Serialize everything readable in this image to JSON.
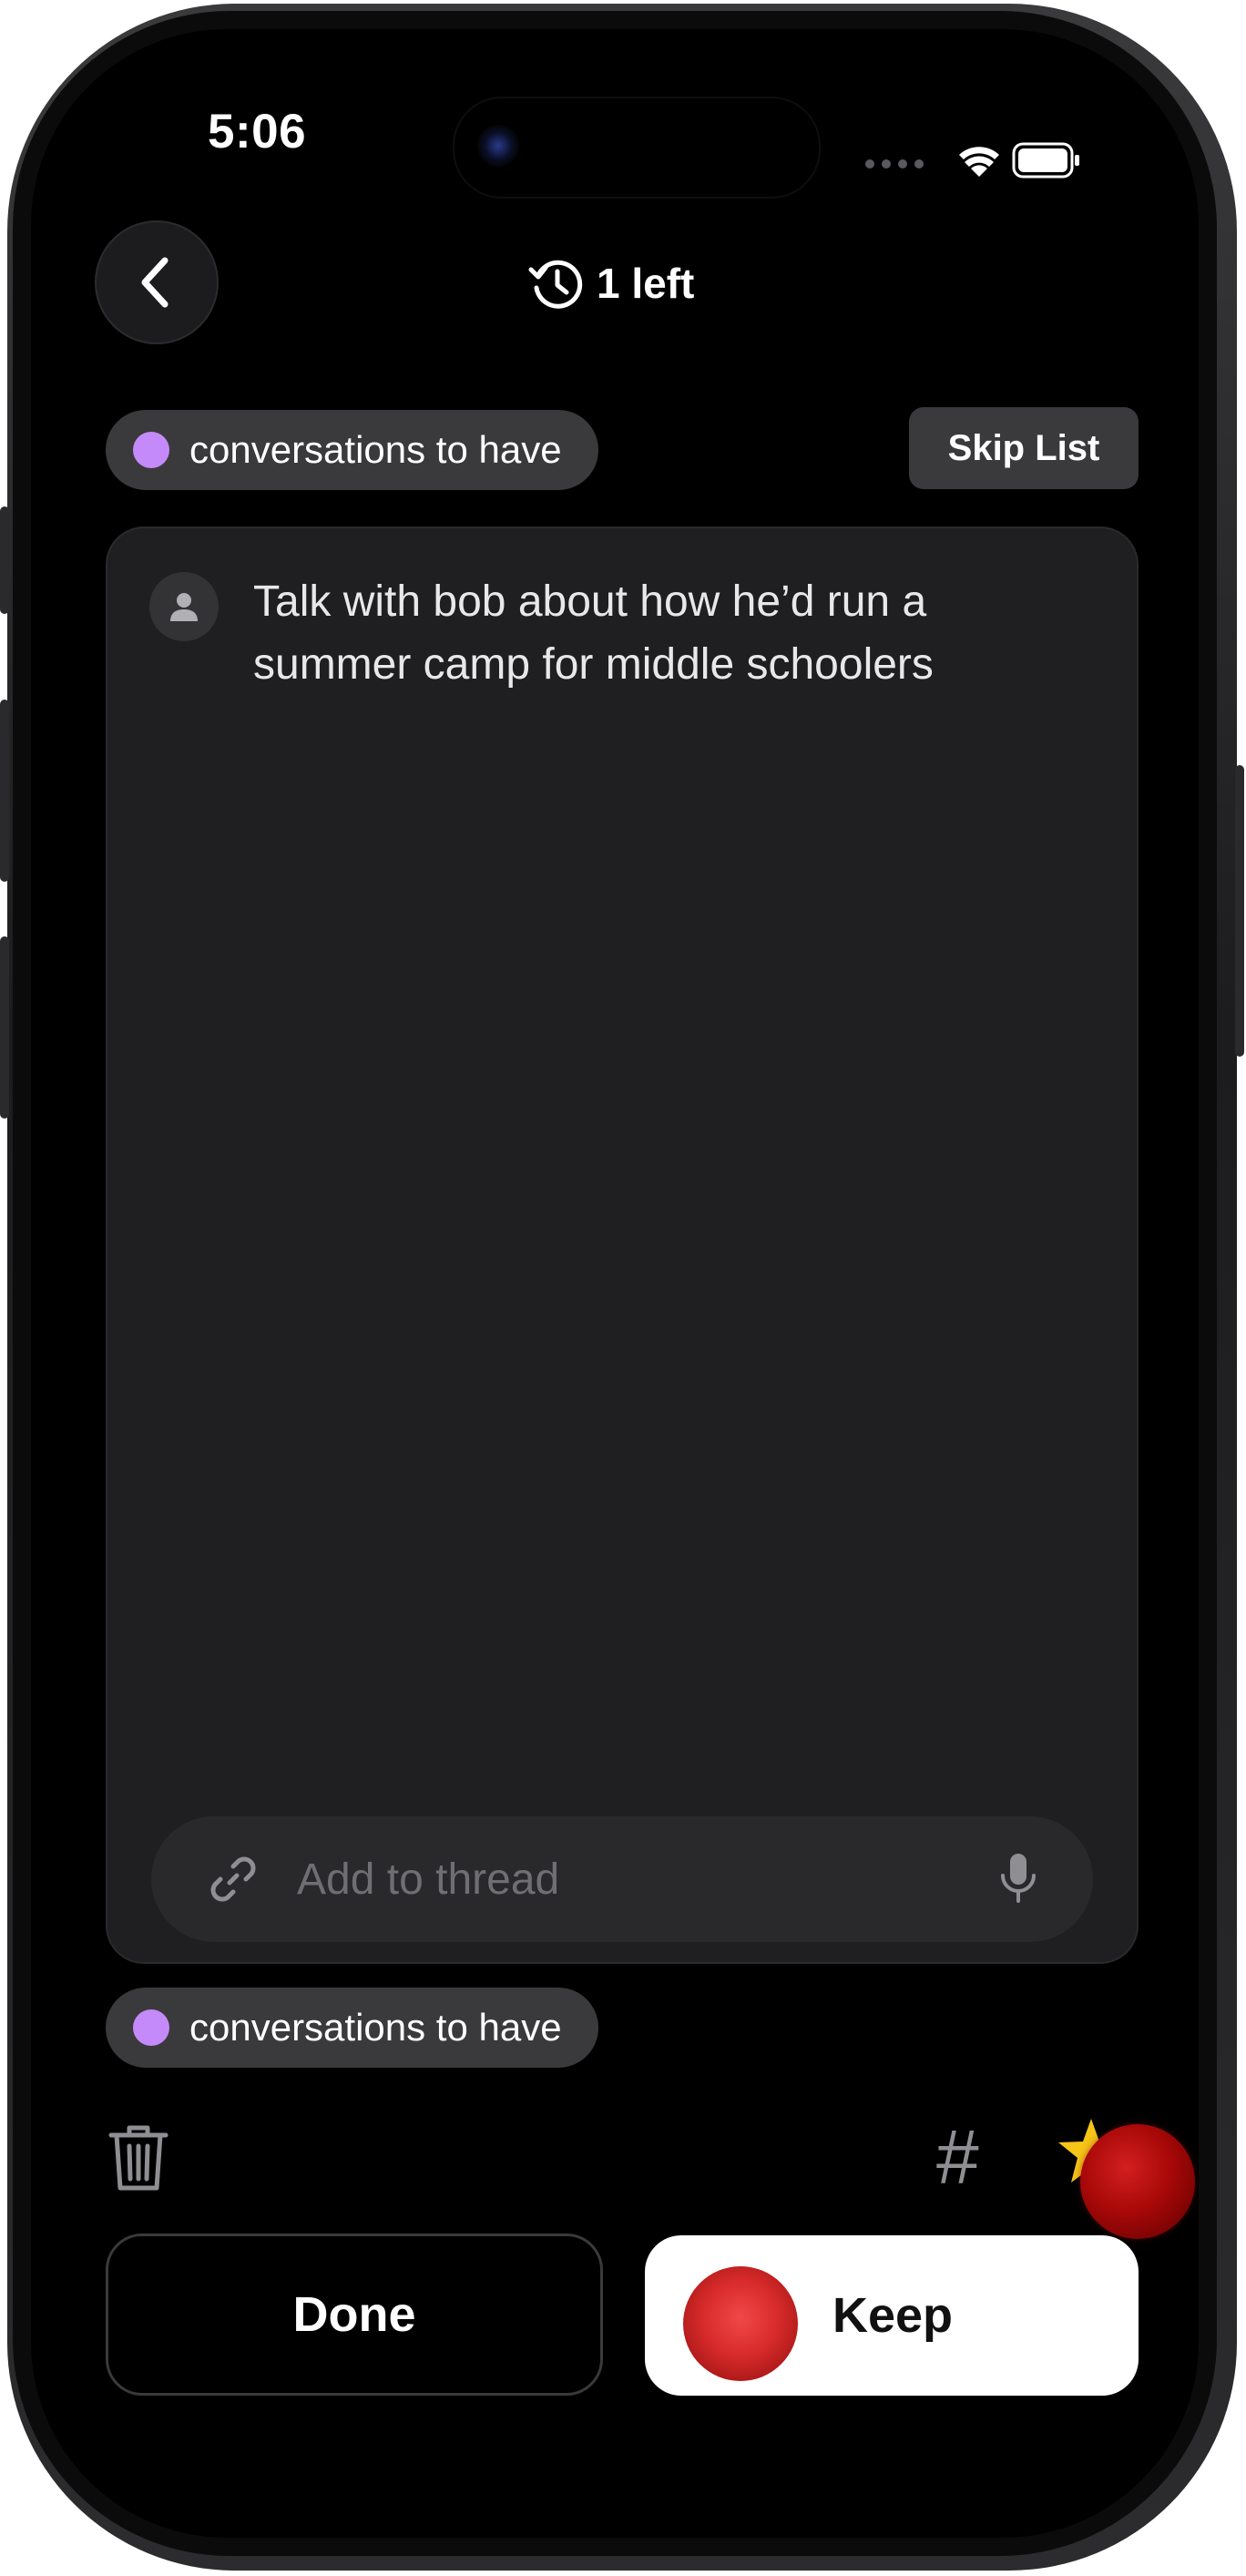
{
  "status_bar": {
    "time": "5:06"
  },
  "header": {
    "remaining_label": "1 left"
  },
  "list_tag": {
    "label": "conversations to have",
    "color": "#c58af9"
  },
  "skip_button": {
    "label": "Skip List"
  },
  "card": {
    "text": "Talk with bob about how he’d run a summer camp for middle schoolers"
  },
  "thread_input": {
    "placeholder": "Add to thread"
  },
  "bottom_tag": {
    "label": "conversations to have",
    "color": "#c58af9"
  },
  "toolbar": {
    "hash_symbol": "#"
  },
  "actions": {
    "done_label": "Done",
    "keep_label": "Keep"
  },
  "icons": [
    "back-chevron-icon",
    "history-icon",
    "person-icon",
    "link-icon",
    "microphone-icon",
    "trash-icon",
    "hashtag-icon",
    "star-icon",
    "wifi-icon",
    "battery-icon",
    "signal-icon"
  ]
}
